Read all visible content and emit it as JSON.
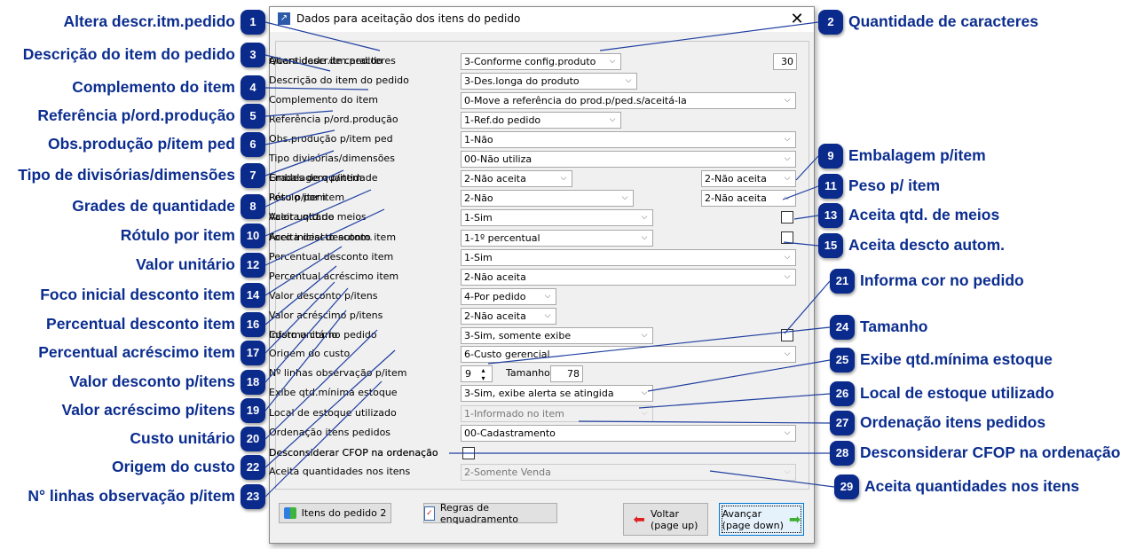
{
  "window": {
    "title": "Dados para aceitação dos itens do pedido",
    "close_icon": "close-icon"
  },
  "form": {
    "rows": [
      {
        "label": "Altera descr.itm.pedido",
        "value": "3-Conforme config.produto"
      },
      {
        "label": "Descrição do item do pedido",
        "value": "3-Des.longa do produto"
      },
      {
        "label": "Complemento do item",
        "value": "0-Move a referência do prod.p/ped.s/aceitá-la"
      },
      {
        "label": "Referência p/ord.produção",
        "value": "1-Ref.do pedido"
      },
      {
        "label": "Obs.produção p/item ped",
        "value": "1-Não"
      },
      {
        "label": "Tipo divisórias/dimensões",
        "value": "00-Não utiliza"
      },
      {
        "label": "Grades de quantidade",
        "value": "2-Não aceita"
      },
      {
        "label": "Rótulo por item",
        "value": "2-Não"
      },
      {
        "label": "Valor unitário",
        "value": "1-Sim"
      },
      {
        "label": "Foco inicial desconto item",
        "value": "1-1º percentual"
      },
      {
        "label": "Percentual desconto item",
        "value": "1-Sim"
      },
      {
        "label": "Percentual acréscimo item",
        "value": "2-Não aceita"
      },
      {
        "label": "Valor desconto p/itens",
        "value": "4-Por pedido"
      },
      {
        "label": "Valor acréscimo p/itens",
        "value": "2-Não aceita"
      },
      {
        "label": "Custo unitário",
        "value": "3-Sim, somente exibe"
      },
      {
        "label": "Origem do custo",
        "value": "6-Custo gerencial"
      },
      {
        "label": "Nº linhas observação p/item",
        "value": "9"
      },
      {
        "label": "Exibe qtd.mínima estoque",
        "value": "3-Sim, exibe alerta se atingida"
      },
      {
        "label": "Local de estoque utilizado",
        "value": "1-Informado no item",
        "disabled": true
      },
      {
        "label": "Ordenação itens pedidos",
        "value": "00-Cadastramento"
      },
      {
        "label": "Desconsiderar CFOP na ordenação",
        "checked": false
      },
      {
        "label": "Aceita quantidades nos itens",
        "value": "2-Somente Venda",
        "disabled": true
      }
    ],
    "quantidade_caracteres": {
      "label": "Quantidade de caracteres",
      "value": "30"
    },
    "embalagem": {
      "label": "Embalagem p/item",
      "value": "2-Não aceita"
    },
    "peso": {
      "label": "Peso p/item",
      "value": "2-Não aceita"
    },
    "aceita_meios": {
      "label": "Aceita qtd.de meios",
      "checked": false
    },
    "aceita_descto": {
      "label": "Aceita descto autom.",
      "checked": false
    },
    "informa_cor": {
      "label": "Informa cor no pedido",
      "checked": false
    },
    "tamanho": {
      "label": "Tamanho",
      "value": "78"
    }
  },
  "buttons": {
    "itens": {
      "label": "Itens do pedido 2",
      "accel": "I",
      "icon": "cubes-icon"
    },
    "regras": {
      "label": "Regras de enquadramento",
      "accel": "R",
      "icon": "checklist-icon"
    },
    "voltar": {
      "line1": "Voltar",
      "line2": "(page up)",
      "icon": "arrow-left-icon",
      "icon_color": "#e02020"
    },
    "avancar": {
      "line1": "Avançar",
      "line2": "(page down)",
      "icon": "arrow-right-icon",
      "icon_color": "#3cb030"
    }
  },
  "callouts": [
    {
      "n": "1",
      "text": "Altera descr.itm.pedido"
    },
    {
      "n": "2",
      "text": "Quantidade de caracteres"
    },
    {
      "n": "3",
      "text": "Descrição do item do pedido"
    },
    {
      "n": "4",
      "text": "Complemento do item"
    },
    {
      "n": "5",
      "text": "Referência p/ord.produção"
    },
    {
      "n": "6",
      "text": "Obs.produção p/item ped"
    },
    {
      "n": "7",
      "text": "Tipo de divisórias/dimensões"
    },
    {
      "n": "8",
      "text": "Grades de quantidade"
    },
    {
      "n": "9",
      "text": "Embalagem p/item"
    },
    {
      "n": "10",
      "text": "Rótulo por item"
    },
    {
      "n": "11",
      "text": "Peso p/ item"
    },
    {
      "n": "12",
      "text": "Valor unitário"
    },
    {
      "n": "13",
      "text": "Aceita qtd. de meios"
    },
    {
      "n": "14",
      "text": "Foco inicial desconto item"
    },
    {
      "n": "15",
      "text": "Aceita descto autom."
    },
    {
      "n": "16",
      "text": "Percentual desconto item"
    },
    {
      "n": "17",
      "text": "Percentual acréscimo item"
    },
    {
      "n": "18",
      "text": "Valor desconto p/itens"
    },
    {
      "n": "19",
      "text": "Valor acréscimo p/itens"
    },
    {
      "n": "20",
      "text": "Custo unitário"
    },
    {
      "n": "21",
      "text": "Informa cor no pedido"
    },
    {
      "n": "22",
      "text": "Origem do custo"
    },
    {
      "n": "23",
      "text": "N° linhas observação p/item"
    },
    {
      "n": "24",
      "text": "Tamanho"
    },
    {
      "n": "25",
      "text": "Exibe qtd.mínima estoque"
    },
    {
      "n": "26",
      "text": "Local de estoque utilizado"
    },
    {
      "n": "27",
      "text": "Ordenação itens pedidos"
    },
    {
      "n": "28",
      "text": "Desconsiderar CFOP na ordenação"
    },
    {
      "n": "29",
      "text": "Aceita quantidades nos itens"
    }
  ],
  "colors": {
    "callout": "#0a2a8c",
    "callout_text": "#0b2d8f",
    "leader": "#1f3f9f"
  }
}
